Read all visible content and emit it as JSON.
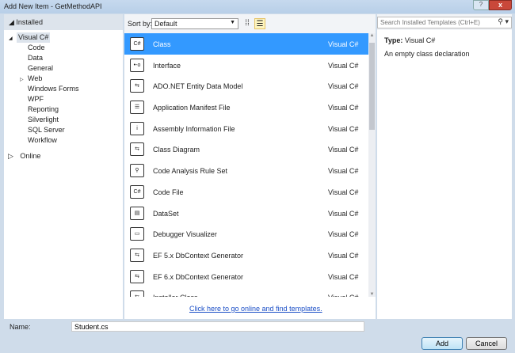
{
  "window": {
    "title": "Add New Item - GetMethodAPI",
    "help": "?",
    "close": "x"
  },
  "tree": {
    "installed": "Installed",
    "items": [
      {
        "label": "Visual C#",
        "indent": 0,
        "arrow": "◢",
        "selected": true
      },
      {
        "label": "Code",
        "indent": 1
      },
      {
        "label": "Data",
        "indent": 1
      },
      {
        "label": "General",
        "indent": 1
      },
      {
        "label": "Web",
        "indent": 1,
        "arrow": "▷"
      },
      {
        "label": "Windows Forms",
        "indent": 1
      },
      {
        "label": "WPF",
        "indent": 1
      },
      {
        "label": "Reporting",
        "indent": 1
      },
      {
        "label": "Silverlight",
        "indent": 1
      },
      {
        "label": "SQL Server",
        "indent": 1
      },
      {
        "label": "Workflow",
        "indent": 1
      }
    ],
    "online": "Online"
  },
  "toolbar": {
    "sort_label": "Sort by:",
    "sort_value": "Default"
  },
  "templates": [
    {
      "name": "Class",
      "lang": "Visual C#",
      "icon": "class-icon",
      "glyph": "C#",
      "selected": true
    },
    {
      "name": "Interface",
      "lang": "Visual C#",
      "icon": "interface-icon",
      "glyph": "•-o"
    },
    {
      "name": "ADO.NET Entity Data Model",
      "lang": "Visual C#",
      "icon": "entity-model-icon",
      "glyph": "⇆"
    },
    {
      "name": "Application Manifest File",
      "lang": "Visual C#",
      "icon": "manifest-icon",
      "glyph": "☰"
    },
    {
      "name": "Assembly Information File",
      "lang": "Visual C#",
      "icon": "assembly-info-icon",
      "glyph": "i"
    },
    {
      "name": "Class Diagram",
      "lang": "Visual C#",
      "icon": "class-diagram-icon",
      "glyph": "⇆"
    },
    {
      "name": "Code Analysis Rule Set",
      "lang": "Visual C#",
      "icon": "rule-set-icon",
      "glyph": "⚲"
    },
    {
      "name": "Code File",
      "lang": "Visual C#",
      "icon": "code-file-icon",
      "glyph": "C#"
    },
    {
      "name": "DataSet",
      "lang": "Visual C#",
      "icon": "dataset-icon",
      "glyph": "▤"
    },
    {
      "name": "Debugger Visualizer",
      "lang": "Visual C#",
      "icon": "debugger-visualizer-icon",
      "glyph": "▭"
    },
    {
      "name": "EF 5.x DbContext Generator",
      "lang": "Visual C#",
      "icon": "ef-generator-icon",
      "glyph": "⇆"
    },
    {
      "name": "EF 6.x DbContext Generator",
      "lang": "Visual C#",
      "icon": "ef-generator-icon",
      "glyph": "⇆"
    },
    {
      "name": "Installer Class",
      "lang": "Visual C#",
      "icon": "installer-class-icon",
      "glyph": "⇆"
    }
  ],
  "online_link": "Click here to go online and find templates.",
  "search": {
    "placeholder": "Search Installed Templates (Ctrl+E)"
  },
  "details": {
    "type_label": "Type:",
    "type_value": "Visual C#",
    "description": "An empty class declaration"
  },
  "name_field": {
    "label": "Name:",
    "value": "Student.cs"
  },
  "buttons": {
    "add": "Add",
    "cancel": "Cancel"
  },
  "colors": {
    "selection": "#3399ff",
    "link": "#1b4fc7"
  }
}
